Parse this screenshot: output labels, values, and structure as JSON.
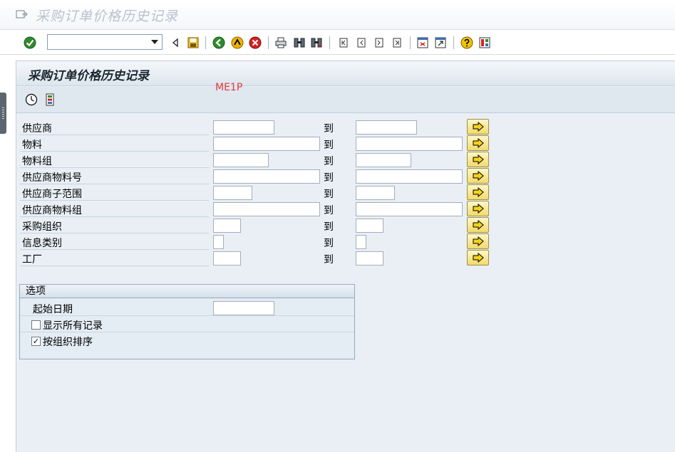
{
  "window": {
    "title": "采购订单价格历史记录"
  },
  "toolbar": {
    "command_field_value": "",
    "icons": [
      "enter-icon",
      "command-dropdown-icon",
      "back-arrow-icon",
      "save-icon",
      "back-icon",
      "exit-icon",
      "cancel-icon",
      "print-icon",
      "find-icon",
      "find-next-icon",
      "first-page-icon",
      "previous-page-icon",
      "next-page-icon",
      "last-page-icon",
      "new-session-icon",
      "shortcut-icon",
      "help-icon",
      "customize-layout-icon"
    ]
  },
  "screen": {
    "title": "采购订单价格历史记录",
    "tcode": "ME1P",
    "app_toolbar_icons": [
      "execute-icon",
      "selection-options-icon"
    ]
  },
  "selection": {
    "to_label": "到",
    "rows": [
      {
        "label": "供应商",
        "from": "",
        "to": ""
      },
      {
        "label": "物料",
        "from": "",
        "to": ""
      },
      {
        "label": "物料组",
        "from": "",
        "to": ""
      },
      {
        "label": "供应商物料号",
        "from": "",
        "to": ""
      },
      {
        "label": "供应商子范围",
        "from": "",
        "to": ""
      },
      {
        "label": "供应商物料组",
        "from": "",
        "to": ""
      },
      {
        "label": "采购组织",
        "from": "",
        "to": ""
      },
      {
        "label": "信息类别",
        "from": "",
        "to": ""
      },
      {
        "label": "工厂",
        "from": "",
        "to": ""
      }
    ]
  },
  "options": {
    "title": "选项",
    "start_date_label": "起始日期",
    "start_date_value": "",
    "show_all_label": "显示所有记录",
    "show_all_checked": false,
    "sort_by_org_label": "按组织排序",
    "sort_by_org_checked": true
  }
}
